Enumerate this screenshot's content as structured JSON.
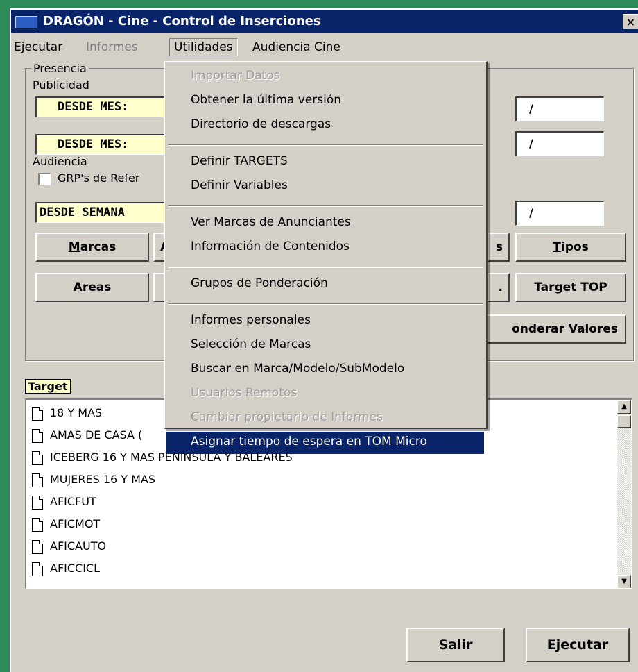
{
  "window": {
    "title": "DRAGÓN - Cine - Control de Inserciones",
    "close": "×"
  },
  "menubar": [
    "Ejecutar",
    "Informes",
    "Utilidades",
    "Audiencia Cine"
  ],
  "presencia": {
    "legend": "Presencia",
    "publicidad_label": "Publicidad",
    "desde_mes_1": "DESDE MES:",
    "desde_mes_2": "DESDE MES:",
    "date1": "/",
    "date2": "/",
    "audiencia_label": "Audiencia",
    "grp_checkbox_label": "GRP's de Refer",
    "desde_semana": "DESDE SEMANA",
    "date3": "/"
  },
  "buttons": {
    "marcas": {
      "pre": "",
      "u": "M",
      "post": "arcas"
    },
    "row1_partial_left": "A",
    "row1_partial_right": "s",
    "tipos": {
      "pre": "",
      "u": "T",
      "post": "ipos"
    },
    "areas": {
      "pre": "A",
      "u": "r",
      "post": "eas"
    },
    "row2_partial_right": ".",
    "target_top": "Target TOP",
    "ponderar": "onderar Valores",
    "salir": {
      "pre": "",
      "u": "S",
      "post": "alir"
    },
    "ejecutar": {
      "pre": "",
      "u": "E",
      "post": "jecutar"
    }
  },
  "target": {
    "label": "Target",
    "items": [
      "18 Y MAS",
      "AMAS DE CASA (",
      "ICEBERG 16 Y MAS PENINSULA Y BALEARES",
      "MUJERES 16 Y MAS",
      "AFICFUT",
      "AFICMOT",
      "AFICAUTO",
      "AFICCICL"
    ],
    "scroll_up": "▲",
    "scroll_down": "▼"
  },
  "dropdown": {
    "groups": [
      [
        {
          "label": "Importar Datos",
          "disabled": true
        },
        {
          "label": "Obtener la última versión"
        },
        {
          "label": "Directorio de descargas"
        }
      ],
      [
        {
          "label": "Definir TARGETS"
        },
        {
          "label": "Definir Variables"
        }
      ],
      [
        {
          "label": "Ver Marcas de Anunciantes"
        },
        {
          "label": "Información de Contenidos"
        }
      ],
      [
        {
          "label": "Grupos de Ponderación"
        }
      ],
      [
        {
          "label": "Informes personales"
        },
        {
          "label": "Selección de Marcas"
        },
        {
          "label": "Buscar en Marca/Modelo/SubModelo"
        },
        {
          "label": "Usuarios Remotos",
          "disabled": true
        },
        {
          "label": "Cambiar propietario de Informes",
          "disabled": true
        },
        {
          "label": "Asignar tiempo de espera en TOM Micro",
          "selected": true
        }
      ]
    ]
  }
}
